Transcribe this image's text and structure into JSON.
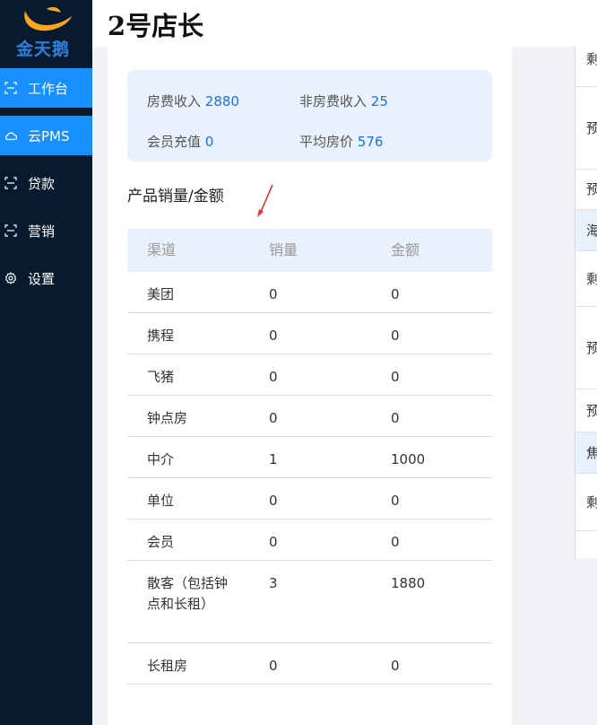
{
  "app": {
    "brand": "金天鹅",
    "store_title": "2号店长"
  },
  "sidebar": {
    "items": [
      {
        "label": "工作台",
        "icon": "scan-icon",
        "active": true
      },
      {
        "label": "云PMS",
        "icon": "cloud-icon",
        "active": true
      },
      {
        "label": "贷款",
        "icon": "scan-icon",
        "active": false
      },
      {
        "label": "营销",
        "icon": "scan-icon",
        "active": false
      },
      {
        "label": "设置",
        "icon": "gear-icon",
        "active": false
      }
    ]
  },
  "summary": {
    "room_income_label": "房费收入",
    "room_income_value": "2880",
    "non_room_income_label": "非房费收入",
    "non_room_income_value": "25",
    "member_recharge_label": "会员充值",
    "member_recharge_value": "0",
    "avg_price_label": "平均房价",
    "avg_price_value": "576"
  },
  "sales": {
    "title": "产品销量/金额",
    "headers": [
      "渠道",
      "销量",
      "金额"
    ],
    "rows": [
      {
        "channel": "美团",
        "qty": "0",
        "amount": "0"
      },
      {
        "channel": "携程",
        "qty": "0",
        "amount": "0"
      },
      {
        "channel": "飞猪",
        "qty": "0",
        "amount": "0"
      },
      {
        "channel": "钟点房",
        "qty": "0",
        "amount": "0"
      },
      {
        "channel": "中介",
        "qty": "1",
        "amount": "1000"
      },
      {
        "channel": "单位",
        "qty": "0",
        "amount": "0"
      },
      {
        "channel": "会员",
        "qty": "0",
        "amount": "0"
      },
      {
        "channel": "散客（包括钟点和长租）",
        "qty": "3",
        "amount": "1880"
      },
      {
        "channel": "长租房",
        "qty": "0",
        "amount": "0"
      }
    ]
  },
  "right_panel": {
    "rows": [
      "剩",
      "预",
      "预",
      "海",
      "剩",
      "预",
      "预",
      "焦",
      "剩"
    ]
  },
  "colors": {
    "sidebar_bg": "#071a2e",
    "active": "#1890ff",
    "accent_value": "#1a73e8",
    "panel_bg": "#e8f1fc"
  }
}
